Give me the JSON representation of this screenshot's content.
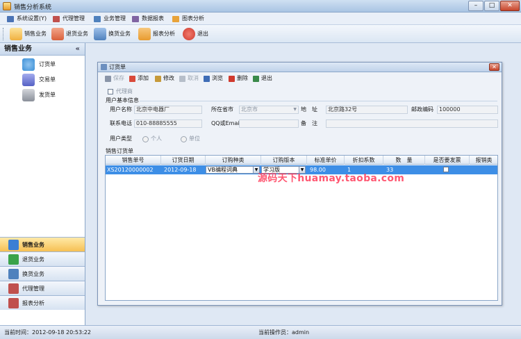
{
  "window": {
    "title": "销售分析系统"
  },
  "menu": {
    "items": [
      {
        "label": "系统设置(Y)",
        "color": "#4a73b5"
      },
      {
        "label": "代理管理",
        "color": "#c0504d"
      },
      {
        "label": "业务管理",
        "color": "#4f81bd"
      },
      {
        "label": "数据报表",
        "color": "#8064a2"
      },
      {
        "label": "图表分析",
        "color": "#e8a33a"
      }
    ]
  },
  "toolbar": {
    "items": [
      {
        "label": "销售业务",
        "icon": "pencil-doc-icon",
        "color": "#f0b040"
      },
      {
        "label": "退货业务",
        "icon": "return-icon",
        "color": "#d9603b"
      },
      {
        "label": "换货业务",
        "icon": "exchange-icon",
        "color": "#4f81bd"
      },
      {
        "label": "报表分析",
        "icon": "report-icon",
        "color": "#e89b2f"
      },
      {
        "label": "退出",
        "icon": "exit-icon",
        "color": "#d03a2e"
      }
    ]
  },
  "sidebar": {
    "title": "销售业务",
    "collapse": "«",
    "items": [
      {
        "label": "订货单",
        "icon": "order-icon",
        "color": "#3b8fd6"
      },
      {
        "label": "交易单",
        "icon": "trade-icon",
        "color": "#5561c4"
      },
      {
        "label": "发货单",
        "icon": "tools-icon",
        "color": "#8a8f99"
      }
    ],
    "nav": [
      {
        "label": "销售业务",
        "color": "#3b7fd4",
        "active": true
      },
      {
        "label": "退货业务",
        "color": "#3aa34a",
        "active": false
      },
      {
        "label": "换货业务",
        "color": "#4f81bd",
        "active": false
      },
      {
        "label": "代理管理",
        "color": "#c0504d",
        "active": false
      },
      {
        "label": "报表分析",
        "color": "#c0504d",
        "active": false
      }
    ]
  },
  "status": {
    "left": "当前时间：2012-09-18 20:53:22",
    "right": "当前操作员：admin"
  },
  "order_window": {
    "title": "订货单",
    "toolbar": [
      {
        "label": "保存",
        "enabled": false,
        "color": "#6a7890"
      },
      {
        "label": "添加",
        "enabled": true,
        "color": "#d94a3b"
      },
      {
        "label": "修改",
        "enabled": true,
        "color": "#c69a3a"
      },
      {
        "label": "取消",
        "enabled": false,
        "color": "#9aa4b0"
      },
      {
        "label": "浏览",
        "enabled": true,
        "color": "#3f6db6"
      },
      {
        "label": "删除",
        "enabled": true,
        "color": "#d03a2e"
      },
      {
        "label": "退出",
        "enabled": true,
        "color": "#3a8a4a"
      }
    ],
    "agent_checkbox": "代理商",
    "section_user": "用户基本信息",
    "fields": {
      "user_name_label": "用户名称",
      "user_name": "北京中电器厂",
      "province_label": "所在省市",
      "province": "北京市",
      "address_label": "地　址",
      "address": "北京路32号",
      "postcode_label": "邮政编码",
      "postcode": "100000",
      "phone_label": "联系电话",
      "phone": "010-88885555",
      "qq_label": "QQ或Email",
      "qq": "",
      "remark_label": "备　注",
      "remark": ""
    },
    "user_type": {
      "label": "用户类型",
      "options": [
        "个人",
        "单位"
      ]
    },
    "section_order": "销售订货单",
    "columns": [
      "销售单号",
      "订货日期",
      "订购种类",
      "订购版本",
      "标准单价",
      "折扣系数",
      "数　量",
      "是否要发票",
      "报销类"
    ],
    "rows": [
      {
        "order_no": "XS20120000002",
        "date": "2012-09-18",
        "type": "VB编程词典",
        "version": "学习版",
        "price": "98.00",
        "discount": "1",
        "qty": "33"
      }
    ]
  },
  "watermark": "源码天下huamay.taoba.com"
}
